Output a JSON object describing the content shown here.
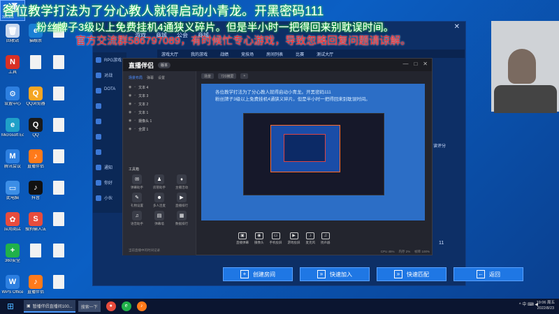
{
  "banners": {
    "line1": "各位教学打法为了分心教人就得启动小青龙。开黑密码111",
    "line2": "粉丝牌子3级以上免费挂机4通狭义碎片。但是半小时一把得回来别耽误时间。",
    "line3": "官方交流群586797089，有时候忙专心游戏，导致忽略回复问题请谅解。"
  },
  "logo": {
    "text": "3通",
    "sub": "391361"
  },
  "desktop_icons": [
    {
      "label": "回收站",
      "glyph": "🗑",
      "color": "#c9d8ee"
    },
    {
      "label": "猫眼票",
      "glyph": "e",
      "color": "#1a7fd4"
    },
    {
      "label": "",
      "glyph": "",
      "color": "",
      "doc": true
    },
    {
      "label": "工具",
      "glyph": "N",
      "color": "#d93025"
    },
    {
      "label": "",
      "glyph": "",
      "color": "",
      "doc": true
    },
    {
      "label": "",
      "glyph": "",
      "color": "",
      "doc": true
    },
    {
      "label": "设置中心",
      "glyph": "⚙",
      "color": "#2d7fe0"
    },
    {
      "label": "QQ浏览器",
      "glyph": "Q",
      "color": "#f5a623"
    },
    {
      "label": "",
      "glyph": "",
      "color": "",
      "doc": true
    },
    {
      "label": "Microsoft Edge",
      "glyph": "e",
      "color": "#1fa0c8"
    },
    {
      "label": "QQ",
      "glyph": "Q",
      "color": "#1a1a1a"
    },
    {
      "label": "",
      "glyph": "",
      "color": "",
      "doc": true
    },
    {
      "label": "腾讯会议",
      "glyph": "M",
      "color": "#2d7fe0"
    },
    {
      "label": "直播伴侣",
      "glyph": "♪",
      "color": "#ff7a1a"
    },
    {
      "label": "",
      "glyph": "",
      "color": "",
      "doc": true
    },
    {
      "label": "此电脑",
      "glyph": "▭",
      "color": "#3c8ee6"
    },
    {
      "label": "抖音",
      "glyph": "♪",
      "color": "#111111"
    },
    {
      "label": "",
      "glyph": "",
      "color": "",
      "doc": true
    },
    {
      "label": "应用商店",
      "glyph": "✿",
      "color": "#e84c3d"
    },
    {
      "label": "搜狗输入法",
      "glyph": "S",
      "color": "#e84c3d"
    },
    {
      "label": "",
      "glyph": "",
      "color": "",
      "doc": true
    },
    {
      "label": "360安全",
      "glyph": "+",
      "color": "#20b14a"
    },
    {
      "label": "",
      "glyph": "",
      "color": "",
      "doc": true
    },
    {
      "label": "",
      "glyph": "",
      "color": "",
      "doc": true
    },
    {
      "label": "WPS Office",
      "glyph": "W",
      "color": "#2d7fe0"
    },
    {
      "label": "直播伴侣",
      "glyph": "♪",
      "color": "#ff7a1a"
    },
    {
      "label": "",
      "glyph": "",
      "color": "",
      "doc": true
    }
  ],
  "game": {
    "top_nav": [
      "游戏",
      "商城",
      "公会",
      "商城"
    ],
    "sub_nav": [
      "游戏大厅",
      "我的游戏",
      "战绩",
      "竞技场",
      "房间列表",
      "比赛",
      "测试大厅"
    ],
    "side_items": [
      "RPG游戏",
      "对战",
      "DOTA",
      "",
      "",
      "",
      "",
      "通知",
      "你好",
      "小伙"
    ],
    "buttons": [
      {
        "label": "创建房间",
        "icon": "+"
      },
      {
        "label": "快速加入",
        "icon": "»"
      },
      {
        "label": "快速匹配",
        "icon": "»"
      },
      {
        "label": "返回",
        "icon": "←"
      }
    ],
    "right_num": "11",
    "right_txt": "读评分"
  },
  "overlay": {
    "title": "直播伴侣",
    "version": "版本",
    "left_tabs": [
      "场景布局",
      "弹幕",
      "设置"
    ],
    "scenes": [
      "文本 4",
      "文本 3",
      "文本 2",
      "文本 1",
      "摄像头 1",
      "全屏 1"
    ],
    "tools_title": "工具箱",
    "tools": [
      {
        "label": "弹幕助手",
        "icon": "✉"
      },
      {
        "label": "房管助手",
        "icon": "♟"
      },
      {
        "label": "主播活动",
        "icon": "♦"
      },
      {
        "label": "礼物设置",
        "icon": "✎"
      },
      {
        "label": "多人连麦",
        "icon": "☻"
      },
      {
        "label": "直播排行",
        "icon": "▶"
      },
      {
        "label": "语音助手",
        "icon": "♫"
      },
      {
        "label": "弹幕墙",
        "icon": "▤"
      },
      {
        "label": "数据排行",
        "icon": "▦"
      }
    ],
    "status": "当前直播中的时间记录",
    "main_tabs": [
      "场景",
      "720横屏",
      "+"
    ],
    "preview_lines": [
      "各位教学打法为了分心教人就得启动小青龙。开黑密码111",
      "粉丝牌子3级以上免费挂机4通狭义碎片。但是半小时一把得回来别耽误时间。"
    ],
    "controls": [
      {
        "label": "直播弹幕",
        "icon": "▣"
      },
      {
        "label": "摄像头",
        "icon": "◉"
      },
      {
        "label": "手机投屏",
        "icon": "▭"
      },
      {
        "label": "游戏投屏",
        "icon": "▶"
      },
      {
        "label": "麦克风",
        "icon": "♪"
      },
      {
        "label": "扬声器",
        "icon": "♫"
      }
    ],
    "stats": [
      "CPU 45%",
      "内存 2%",
      "帧率 100%"
    ]
  },
  "taskbar": {
    "app_label": "暂播伴侣直播间100...",
    "search": "搜索一下",
    "tray": "^ 中 ⌨ ◀",
    "time": "19:06 周五",
    "date": "2022/8/23"
  }
}
